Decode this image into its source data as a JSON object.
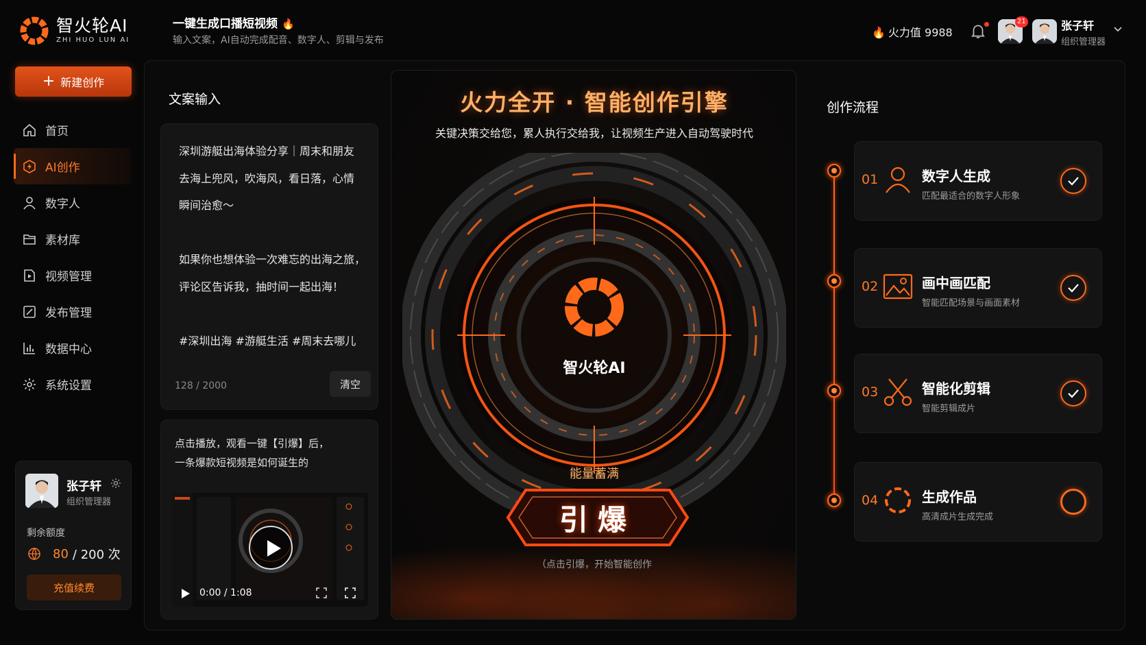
{
  "brand": {
    "name_cn": "智火轮AI",
    "name_en": "ZHI HUO LUN AI",
    "accent": "#ff6a1a"
  },
  "header": {
    "title": "一键生成口播短视频",
    "subtitle": "输入文案，AI自动完成配音、数字人、剪辑与发布",
    "power_label": "火力值 9988",
    "notifications_badge": "21",
    "user_name": "张子轩",
    "user_role": "组织管理器"
  },
  "sidebar": {
    "new_button": "新建创作",
    "items": [
      {
        "label": "首页",
        "icon": "home-icon"
      },
      {
        "label": "AI创作",
        "icon": "ai-create-icon",
        "active": true
      },
      {
        "label": "数字人",
        "icon": "person-icon"
      },
      {
        "label": "素材库",
        "icon": "folder-icon"
      },
      {
        "label": "视频管理",
        "icon": "video-file-icon"
      },
      {
        "label": "发布管理",
        "icon": "edit-icon"
      },
      {
        "label": "数据中心",
        "icon": "chart-icon"
      },
      {
        "label": "系统设置",
        "icon": "gear-icon"
      }
    ],
    "user_card": {
      "name": "张子轩",
      "role": "组织管理器",
      "quota_label": "剩余额度",
      "quota_used": "80",
      "quota_rest": "/ 200 次",
      "recharge": "充值续费"
    }
  },
  "copy_input": {
    "title": "文案输入",
    "text": "深圳游艇出海体验分享｜周末和朋友\n去海上兜风，吹海风，看日落，心情\n瞬间治愈～\n\n如果你也想体验一次难忘的出海之旅，\n评论区告诉我，抽时间一起出海！\n\n#深圳出海 #游艇生活 #周末去哪儿",
    "count": "128 / 2000",
    "clear": "清空"
  },
  "demo_video": {
    "desc": "点击播放，观看一键【引爆】后，\n一条爆款短视频是如何诞生的",
    "time": "0:00 / 1:08"
  },
  "engine": {
    "title": "火力全开 · 智能创作引擎",
    "subtitle": "关键决策交给您，累人执行交给我，让视频生产进入自动驾驶时代",
    "center_label": "智火轮AI",
    "energy": "能量蓄满",
    "ignite": "引爆",
    "hint": "（点击引爆，开始智能创作"
  },
  "flow": {
    "title": "创作流程",
    "steps": [
      {
        "num": "01",
        "title": "数字人生成",
        "desc": "匹配最适合的数字人形象",
        "icon": "person-icon",
        "done": true
      },
      {
        "num": "02",
        "title": "画中画匹配",
        "desc": "智能匹配场景与画面素材",
        "icon": "image-icon",
        "done": true
      },
      {
        "num": "03",
        "title": "智能化剪辑",
        "desc": "智能剪辑成片",
        "icon": "scissors-icon",
        "done": true
      },
      {
        "num": "04",
        "title": "生成作品",
        "desc": "高清成片生成完成",
        "icon": "loading-icon",
        "done": false
      }
    ]
  }
}
